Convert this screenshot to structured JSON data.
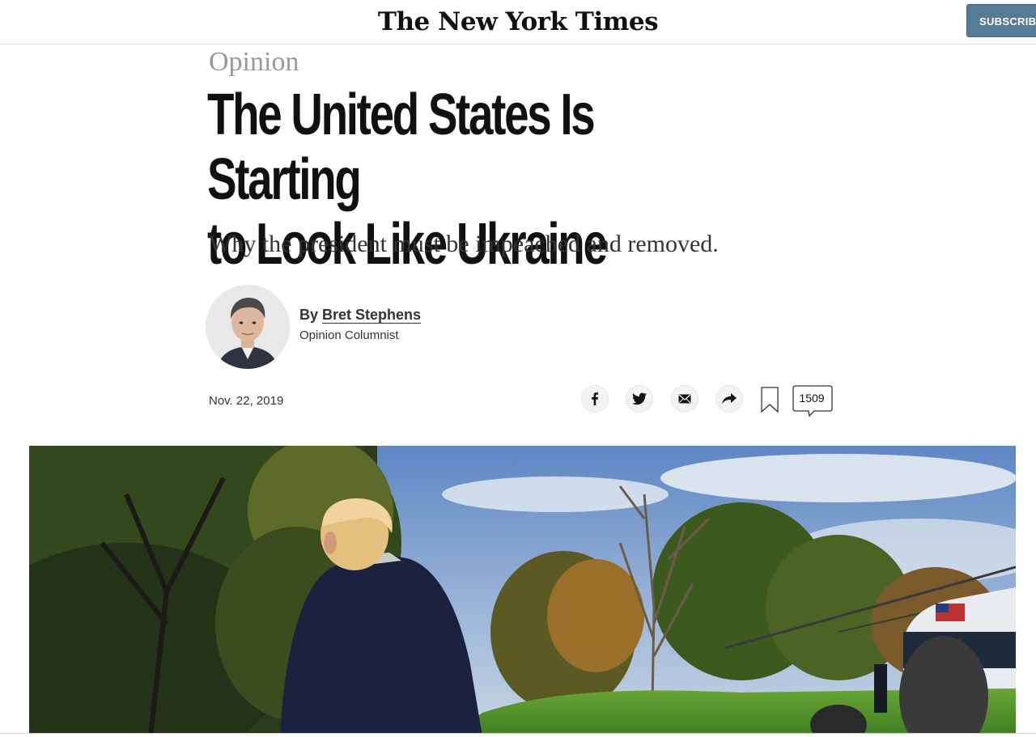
{
  "header": {
    "masthead": "The New York Times",
    "subscribe_label": "SUBSCRIBE"
  },
  "article": {
    "kicker": "Opinion",
    "headline_line1": "The United States Is Starting",
    "headline_line2": "to Look Like Ukraine",
    "summary": "Why the president must be impeached and removed.",
    "byline_prefix": "By",
    "author": "Bret Stephens",
    "author_role": "Opinion Columnist",
    "date": "Nov. 22, 2019"
  },
  "share": {
    "icons": [
      "facebook-icon",
      "twitter-icon",
      "email-icon",
      "share-icon",
      "bookmark-icon"
    ],
    "comment_count": "1509"
  },
  "colors": {
    "subscribe_bg": "#567b95",
    "kicker": "#999999",
    "text": "#121212"
  }
}
